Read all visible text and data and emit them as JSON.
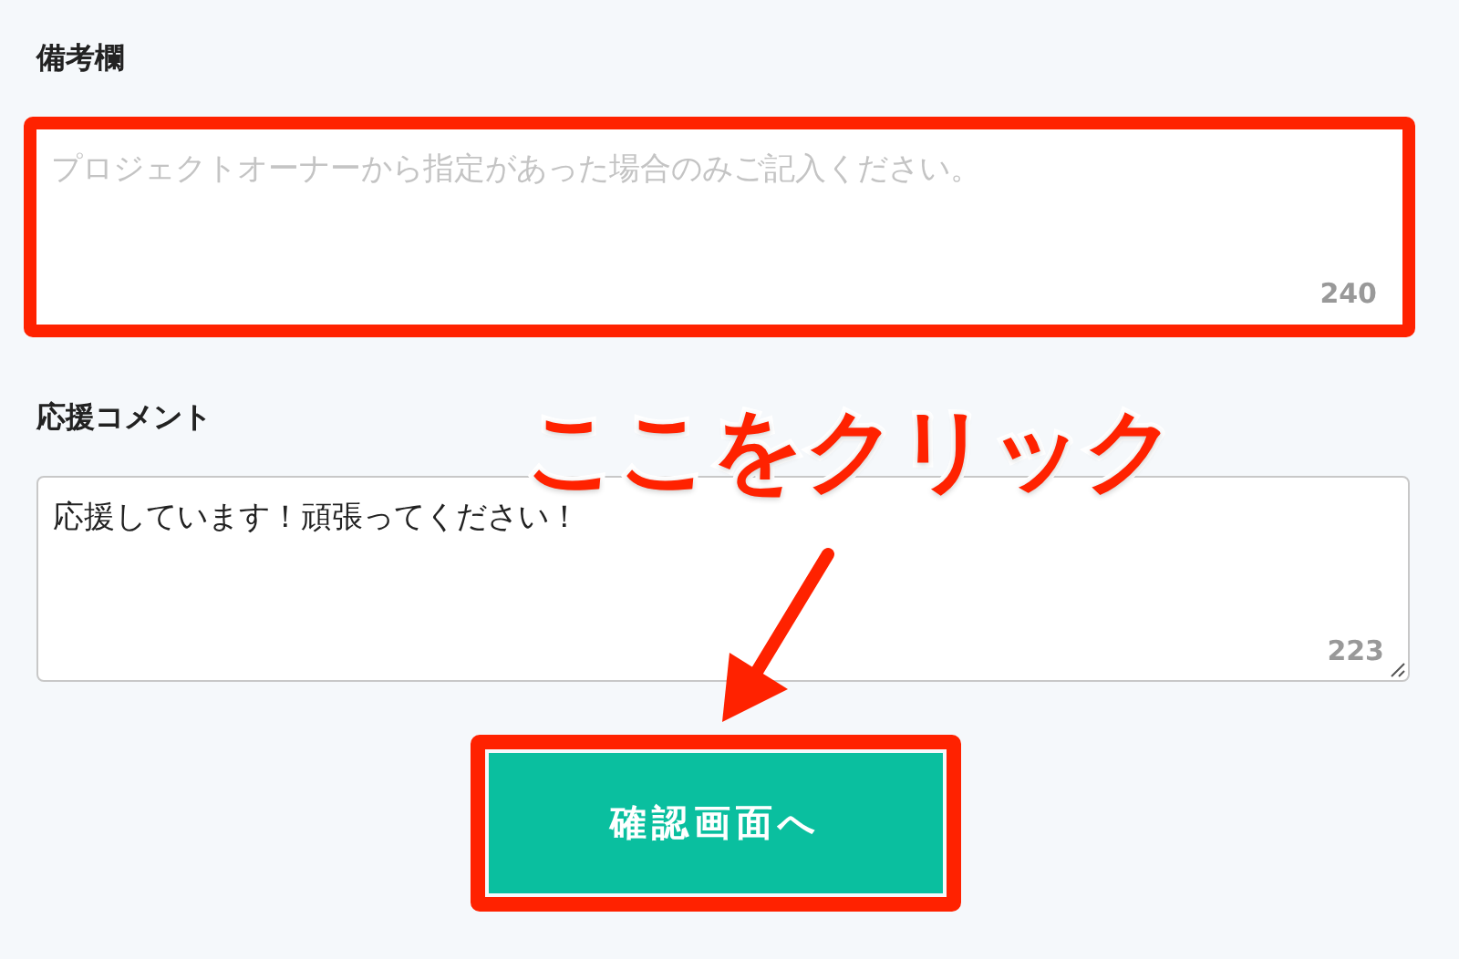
{
  "fields": [
    {
      "label": "備考欄",
      "placeholder": "プロジェクトオーナーから指定があった場合のみご記入ください。",
      "counter": "240",
      "highlighted": true,
      "resizable": false
    },
    {
      "label": "応援コメント",
      "value": "応援しています！頑張ってください！",
      "counter": "223",
      "highlighted": false,
      "resizable": true
    }
  ],
  "button": {
    "label": "確認画面へ",
    "highlighted": true
  },
  "annotation": {
    "text": "ここをクリック"
  }
}
